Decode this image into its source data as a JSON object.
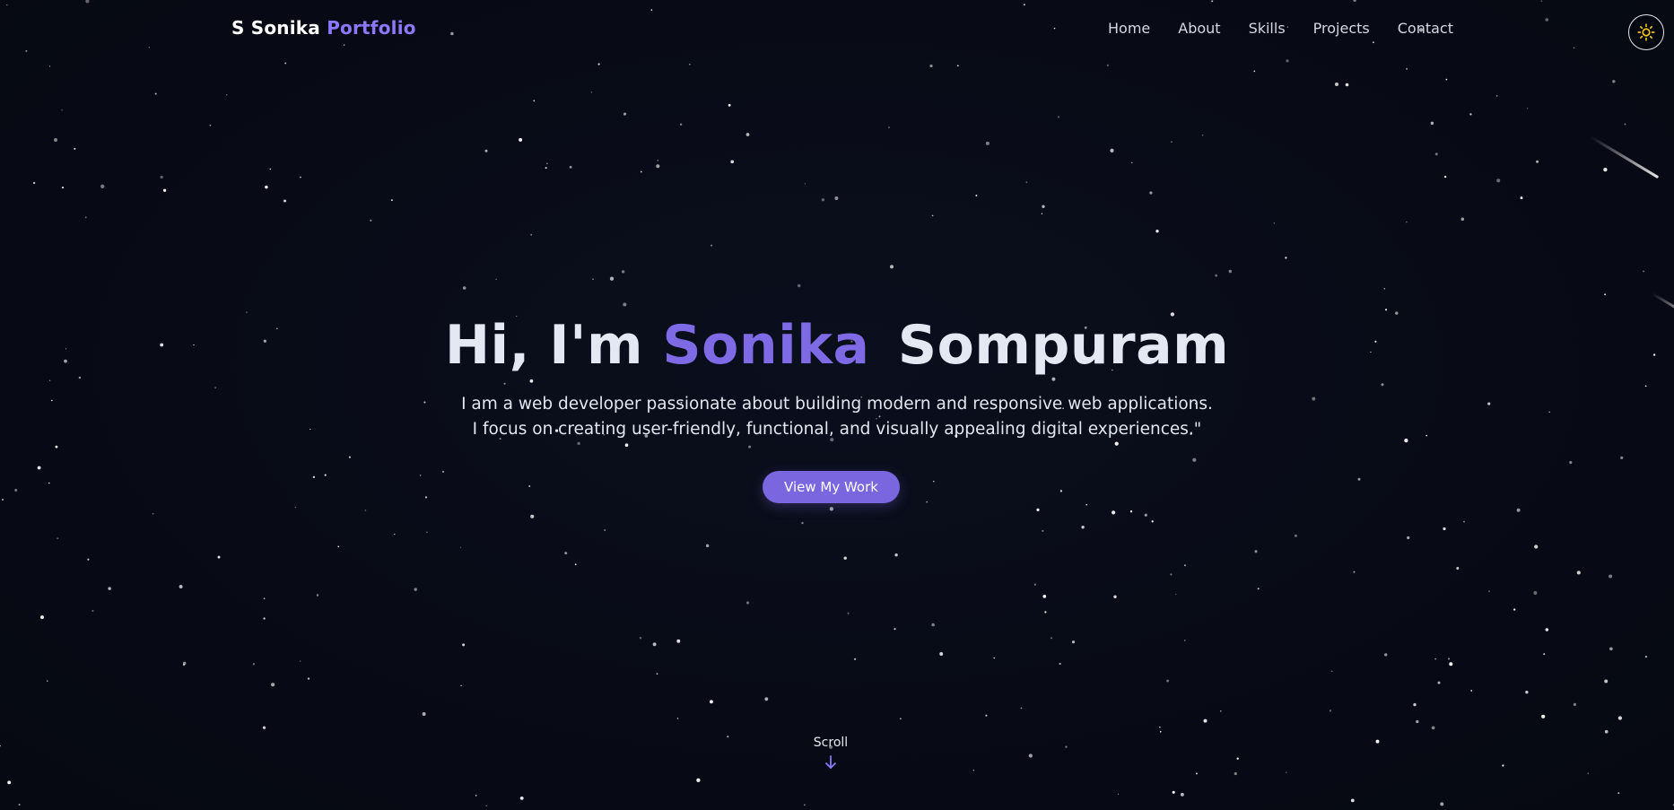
{
  "brand": {
    "first": "S Sonika",
    "accent": "Portfolio"
  },
  "nav": {
    "items": [
      "Home",
      "About",
      "Skills",
      "Projects",
      "Contact"
    ]
  },
  "theme_toggle": {
    "icon": "sun-icon",
    "color": "#f5c518"
  },
  "hero": {
    "greeting": "Hi, I'm",
    "first_name": "Sonika",
    "last_name": "Sompuram",
    "subtitle": "I am a web developer passionate about building modern and responsive web applications. I focus on creating user-friendly, functional, and visually appealing digital experiences.\"",
    "cta_label": "View My Work"
  },
  "scroll": {
    "label": "Scroll",
    "icon": "arrow-down-icon"
  },
  "colors": {
    "background": "#080b16",
    "accent": "#7f6ae6",
    "button": "#7a67e0",
    "text": "#e4e8f2"
  }
}
